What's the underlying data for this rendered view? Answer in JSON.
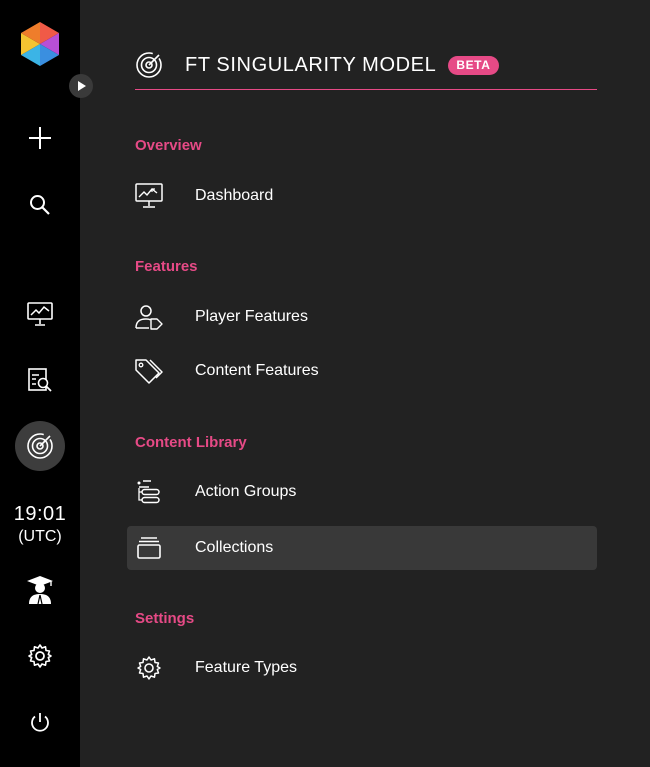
{
  "header": {
    "title": "FT SINGULARITY MODEL",
    "badge": "BETA"
  },
  "clock": {
    "time": "19:01",
    "timezone": "(UTC)"
  },
  "sections": {
    "overview": "Overview",
    "features": "Features",
    "content_library": "Content Library",
    "settings": "Settings"
  },
  "nav": {
    "dashboard": "Dashboard",
    "player_features": "Player Features",
    "content_features": "Content Features",
    "action_groups": "Action Groups",
    "collections": "Collections",
    "feature_types": "Feature Types"
  },
  "icons": {
    "rail": [
      "logo-icon",
      "expand-icon",
      "plus-icon",
      "search-icon",
      "dashboard-icon",
      "report-search-icon",
      "target-icon",
      "graduate-icon",
      "gear-icon",
      "power-icon"
    ],
    "panel": [
      "target-icon",
      "monitor-chart-icon",
      "user-tag-icon",
      "tags-icon",
      "list-icon",
      "archive-icon",
      "gear-icon"
    ]
  },
  "colors": {
    "accent": "#e64a86",
    "rail_bg": "#000000",
    "panel_bg": "#222222",
    "active_bg": "#393939"
  },
  "active_item": "Collections"
}
